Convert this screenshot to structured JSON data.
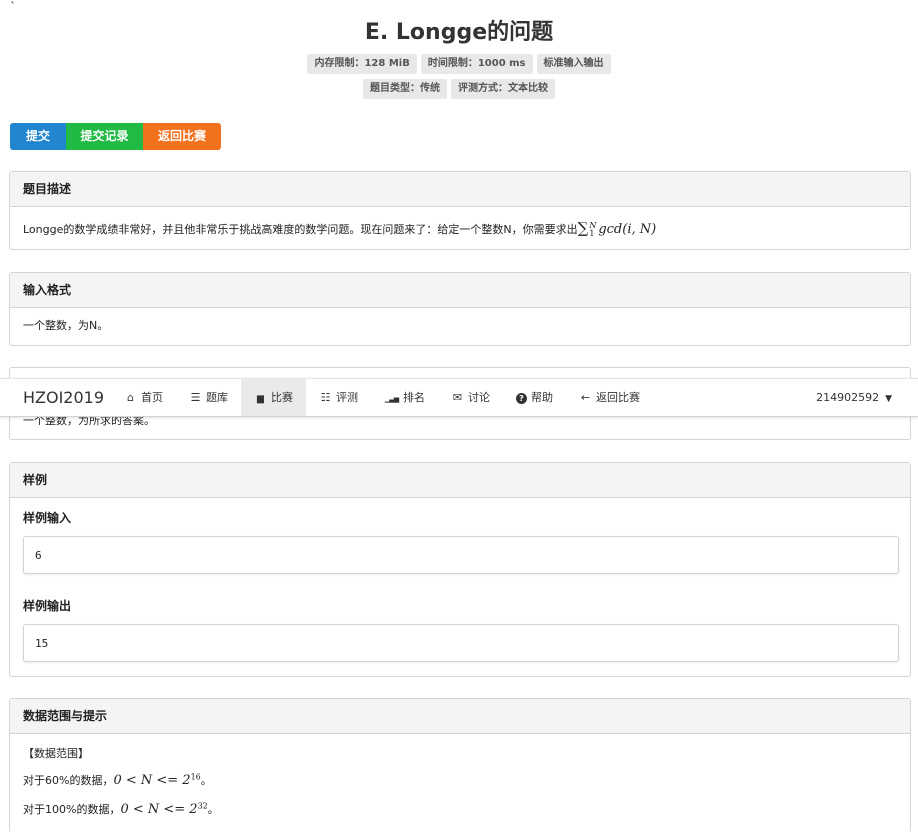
{
  "backtick": "`",
  "problem": {
    "title": "E. Longge的问题",
    "labels_row1": [
      "内存限制：128 MiB",
      "时间限制：1000 ms",
      "标准输入输出"
    ],
    "labels_row2": [
      "题目类型：传统",
      "评测方式：文本比较"
    ]
  },
  "buttons": {
    "submit": "提交",
    "records": "提交记录",
    "back": "返回比赛"
  },
  "colors": {
    "submit": "#2185d0",
    "records": "#21ba45",
    "back": "#f2711c"
  },
  "description": {
    "heading": "题目描述",
    "text": "Longge的数学成绩非常好，并且他非常乐于挑战高难度的数学问题。现在问题来了：给定一个整数N，你需要求出",
    "formula_sum": "∑",
    "formula_upper": "N",
    "formula_lower": "1",
    "formula_func": "gcd(i, N)"
  },
  "input_format": {
    "heading": "输入格式",
    "text": "一个整数，为N。"
  },
  "output_format": {
    "text": "一个整数，为所求的答案。"
  },
  "sample": {
    "heading": "样例",
    "input_label": "样例输入",
    "input_value": "6",
    "output_label": "样例输出",
    "output_value": "15"
  },
  "hint": {
    "heading": "数据范围与提示",
    "line1": "【数据范围】",
    "line2_prefix": "对于60%的数据，",
    "line2_math": "0 < N <= 2",
    "line2_exp": "16",
    "line2_suffix": "。",
    "line3_prefix": "对于100%的数据，",
    "line3_math": "0 < N <= 2",
    "line3_exp": "32",
    "line3_suffix": "。"
  },
  "navbar": {
    "brand": "HZOI2019",
    "items": [
      {
        "label": "首页",
        "icon": "home-icon",
        "glyph": "⌂"
      },
      {
        "label": "题库",
        "icon": "list-icon",
        "glyph": "☰"
      },
      {
        "label": "比赛",
        "icon": "calendar-icon",
        "glyph": "▆"
      },
      {
        "label": "评测",
        "icon": "tasks-icon",
        "glyph": "☷"
      },
      {
        "label": "排名",
        "icon": "signal-icon",
        "glyph": "▁▃▅"
      },
      {
        "label": "讨论",
        "icon": "comments-icon",
        "glyph": "✉"
      },
      {
        "label": "帮助",
        "icon": "help-icon",
        "glyph": "?"
      },
      {
        "label": "返回比赛",
        "icon": "arrow-left-icon",
        "glyph": "←"
      }
    ],
    "active_label": "比赛",
    "user": "214902592",
    "caret": "▼"
  }
}
